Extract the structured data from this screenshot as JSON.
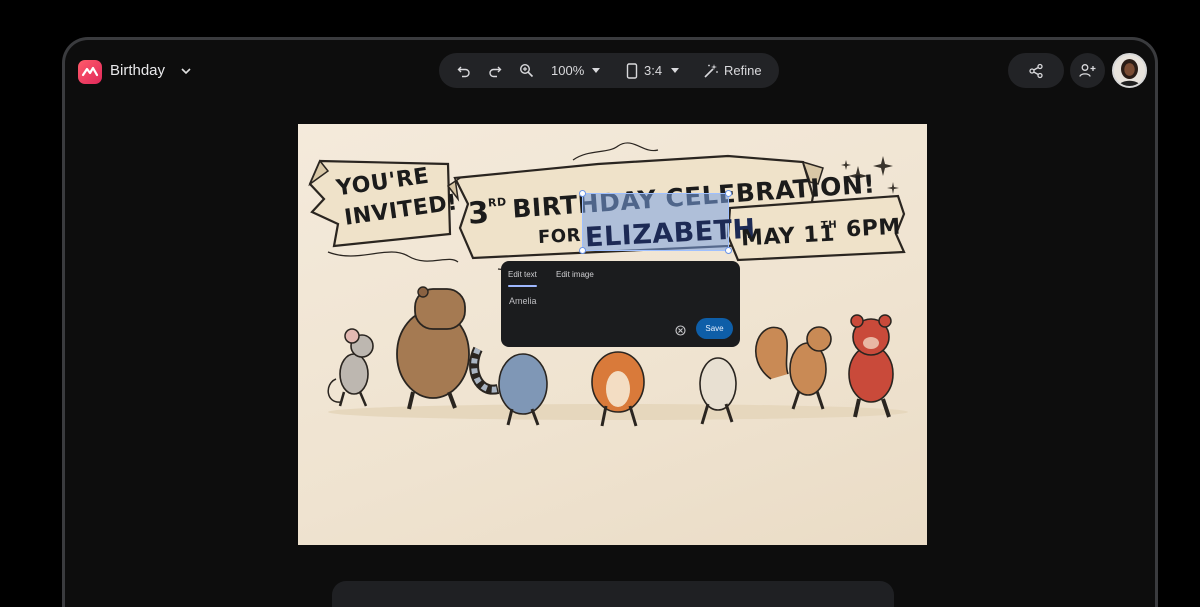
{
  "header": {
    "doc_title": "Birthday",
    "toolbar": {
      "zoom": "100%",
      "aspect": "3:4",
      "refine": "Refine"
    }
  },
  "card": {
    "banner_left": [
      "YOU'RE",
      "INVITED!"
    ],
    "line1_num": "3",
    "line1_sup": "RD",
    "line1_rest": "BIRTHDAY CELEBRATION!",
    "line2_for": "FOR",
    "line2_name": "ELIZABETH",
    "date_day": "MAY 11",
    "date_sup": "TH",
    "date_time": "6PM"
  },
  "edit_popup": {
    "tabs": [
      "Edit text",
      "Edit image"
    ],
    "input_value": "Amelia",
    "save": "Save"
  },
  "icons": [
    "app-logo-icon",
    "chevron-down-icon",
    "undo-icon",
    "redo-icon",
    "zoom-icon",
    "device-icon",
    "sparkle-wand-icon",
    "share-icon",
    "add-person-icon",
    "clear-icon"
  ]
}
